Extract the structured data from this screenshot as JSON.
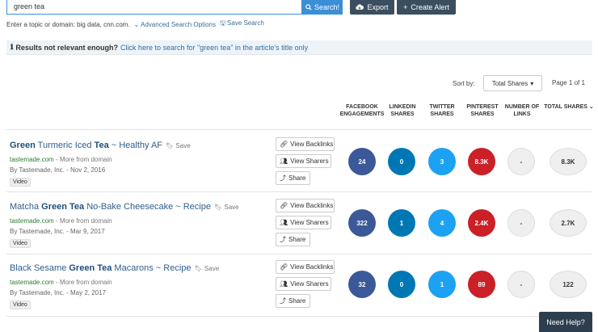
{
  "search": {
    "value": "green tea",
    "button_label": "Search!"
  },
  "toolbar": {
    "export_label": "Export",
    "create_alert_label": "Create Alert"
  },
  "helper": {
    "hint": "Enter a topic or domain: big data, cnn.com.",
    "advanced": "Advanced Search Options",
    "save": "Save Search"
  },
  "banner": {
    "prefix": "Results not relevant enough?",
    "link": "Click here to search for \"green tea\" in the article's title only"
  },
  "sort": {
    "label": "Sort by:",
    "selected": "Total Shares",
    "page": "Page 1 of 1"
  },
  "columns": [
    {
      "line1": "FACEBOOK",
      "line2": "ENGAGEMENTS"
    },
    {
      "line1": "LINKEDIN",
      "line2": "SHARES"
    },
    {
      "line1": "TWITTER",
      "line2": "SHARES"
    },
    {
      "line1": "PINTEREST",
      "line2": "SHARES"
    },
    {
      "line1": "NUMBER OF",
      "line2": "LINKS"
    },
    {
      "line1": "TOTAL SHARES",
      "line2": ""
    }
  ],
  "actions": {
    "backlinks": "View Backlinks",
    "sharers": "View Sharers",
    "share": "Share",
    "save": "Save"
  },
  "results": [
    {
      "title_pre": "",
      "title_b1": "Green",
      "title_mid": " Turmeric Iced ",
      "title_b2": "Tea",
      "title_post": " ~ Healthy AF",
      "domain": "tastemade.com",
      "more": " - More from domain",
      "meta": "By Tastemade, Inc. - Nov 2, 2016",
      "tag": "Video",
      "facebook": "24",
      "linkedin": "0",
      "twitter": "3",
      "pinterest": "8.3K",
      "links": "-",
      "total": "8.3K"
    },
    {
      "title_pre": "Matcha ",
      "title_b1": "Green Tea",
      "title_mid": " No-Bake Cheesecake ~ Recipe",
      "title_b2": "",
      "title_post": "",
      "domain": "tastemade.com",
      "more": " - More from domain",
      "meta": "By Tastemade, Inc. - Mar 9, 2017",
      "tag": "Video",
      "facebook": "322",
      "linkedin": "1",
      "twitter": "4",
      "pinterest": "2.4K",
      "links": "-",
      "total": "2.7K"
    },
    {
      "title_pre": "Black Sesame ",
      "title_b1": "Green Tea",
      "title_mid": " Macarons ~ Recipe",
      "title_b2": "",
      "title_post": "",
      "domain": "tastemade.com",
      "more": " - More from domain",
      "meta": "By Tastemade, Inc. - May 2, 2017",
      "tag": "Video",
      "facebook": "32",
      "linkedin": "0",
      "twitter": "1",
      "pinterest": "89",
      "links": "-",
      "total": "122"
    }
  ],
  "colors": {
    "facebook": "#3b5998",
    "linkedin": "#0077b5",
    "twitter": "#1da1f2",
    "pinterest": "#cb2027",
    "primary": "#3a8fd6",
    "dark": "#3b4e60"
  },
  "need_help": "Need Help?"
}
